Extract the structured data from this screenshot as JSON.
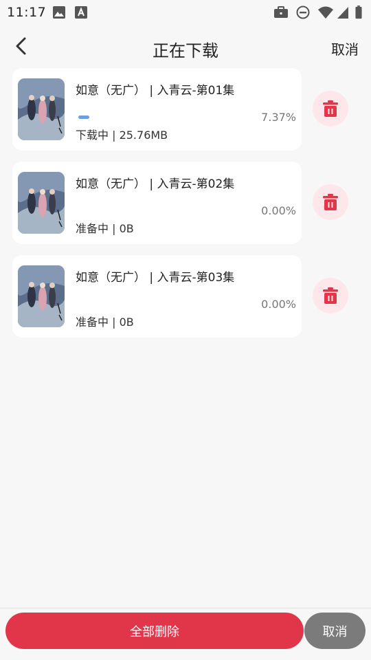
{
  "status_bar": {
    "time": "11:17",
    "left_icons": [
      "image-icon",
      "font-icon"
    ],
    "right_icons": [
      "briefcase-icon",
      "do-not-disturb-icon",
      "wifi-icon",
      "signal-icon",
      "battery-icon"
    ]
  },
  "header": {
    "title": "正在下载",
    "cancel_label": "取消",
    "back_icon": "chevron-left-icon"
  },
  "downloads": [
    {
      "title": "如意（无广） | 入青云-第01集",
      "status": "下载中 | 25.76MB",
      "percent": "7.37%",
      "progress": 0.0737
    },
    {
      "title": "如意（无广） | 入青云-第02集",
      "status": "准备中 | 0B",
      "percent": "0.00%",
      "progress": 0
    },
    {
      "title": "如意（无广） | 入青云-第03集",
      "status": "准备中 | 0B",
      "percent": "0.00%",
      "progress": 0
    }
  ],
  "footer": {
    "delete_all_label": "全部删除",
    "cancel_label": "取消"
  },
  "colors": {
    "accent_red": "#e1364a",
    "delete_bg": "#fde7ea",
    "progress_blue": "#6b9fe2",
    "cancel_grey": "#7b7b7b"
  }
}
